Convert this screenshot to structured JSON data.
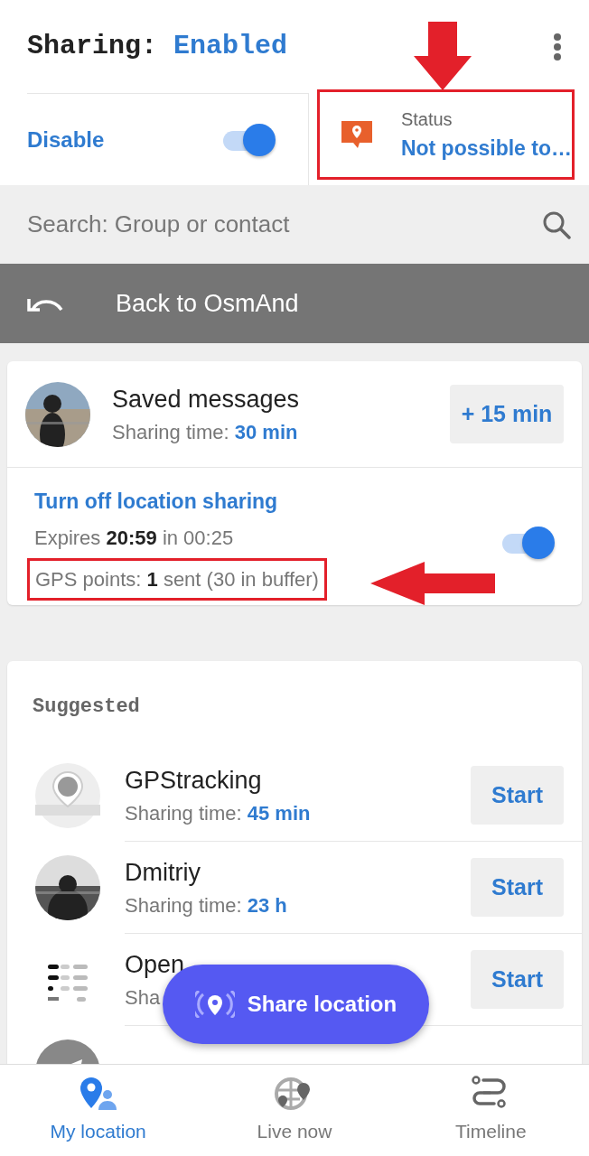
{
  "header": {
    "title": "Sharing:",
    "state": "Enabled"
  },
  "sharing_toggle": {
    "label": "Disable",
    "on": true
  },
  "status": {
    "label": "Status",
    "value": "Not possible to…",
    "highlighted": true,
    "arrow": true
  },
  "search": {
    "placeholder": "Search: Group or contact"
  },
  "back_bar": {
    "label": "Back to OsmAnd"
  },
  "active_chat": {
    "name": "Saved messages",
    "sharing_label": "Sharing time:",
    "sharing_value": "30 min",
    "extend_button": "+ 15 min",
    "action_link": "Turn off location sharing",
    "expires": "Expires **20:59** in 00:25",
    "gps": "GPS points: **1** sent (30 in buffer)",
    "gps_highlighted": true,
    "gps_arrow": true,
    "on": true
  },
  "suggested": {
    "title": "Suggested",
    "items": [
      {
        "name": "GPStracking",
        "kind": "pin",
        "sharing_label": "Sharing time:",
        "sharing_value": "45 min",
        "button": "Start"
      },
      {
        "name": "Dmitriy",
        "sharing_label": "Sharing time:",
        "sharing_value": "23 h",
        "button": "Start"
      },
      {
        "name": "Open",
        "kind": "list",
        "sharing_label": "Sha",
        "button": "Start"
      },
      {
        "kind": "plane"
      }
    ]
  },
  "fab": {
    "label": "Share location"
  },
  "bottom_nav": [
    {
      "label": "My location",
      "selected": true
    },
    {
      "label": "Live now",
      "selected": false
    },
    {
      "label": "Timeline",
      "selected": false
    }
  ]
}
